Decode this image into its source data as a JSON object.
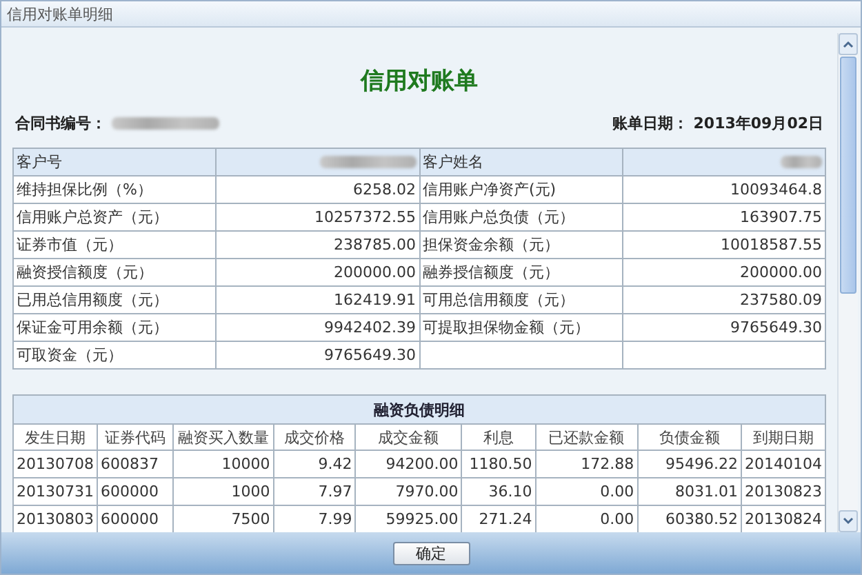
{
  "window": {
    "title": "信用对账单明细"
  },
  "statement": {
    "title": "信用对账单",
    "contract_label": "合同书编号：",
    "date_label": "账单日期：",
    "date": "2013年09月02日"
  },
  "summary": {
    "rows": [
      {
        "highlighted": true,
        "cells": [
          {
            "kind": "label",
            "text": "客户号"
          },
          {
            "kind": "redacted"
          },
          {
            "kind": "label",
            "text": "客户姓名"
          },
          {
            "kind": "redacted"
          }
        ]
      },
      {
        "highlighted": false,
        "cells": [
          {
            "kind": "label",
            "text": "维持担保比例（%）"
          },
          {
            "kind": "value",
            "text": "6258.02"
          },
          {
            "kind": "label",
            "text": "信用账户净资产(元)"
          },
          {
            "kind": "value",
            "text": "10093464.8"
          }
        ]
      },
      {
        "highlighted": false,
        "cells": [
          {
            "kind": "label",
            "text": "信用账户总资产（元）"
          },
          {
            "kind": "value",
            "text": "10257372.55"
          },
          {
            "kind": "label",
            "text": "信用账户总负债（元）"
          },
          {
            "kind": "value",
            "text": "163907.75"
          }
        ]
      },
      {
        "highlighted": false,
        "cells": [
          {
            "kind": "label",
            "text": "证券市值（元）"
          },
          {
            "kind": "value",
            "text": "238785.00"
          },
          {
            "kind": "label",
            "text": "担保资金余额（元）"
          },
          {
            "kind": "value",
            "text": "10018587.55"
          }
        ]
      },
      {
        "highlighted": false,
        "cells": [
          {
            "kind": "label",
            "text": "融资授信额度（元）"
          },
          {
            "kind": "value",
            "text": "200000.00"
          },
          {
            "kind": "label",
            "text": "融券授信额度（元）"
          },
          {
            "kind": "value",
            "text": "200000.00"
          }
        ]
      },
      {
        "highlighted": false,
        "cells": [
          {
            "kind": "label",
            "text": "已用总信用额度（元）"
          },
          {
            "kind": "value",
            "text": "162419.91"
          },
          {
            "kind": "label",
            "text": "可用总信用额度（元）"
          },
          {
            "kind": "value",
            "text": "237580.09"
          }
        ]
      },
      {
        "highlighted": false,
        "cells": [
          {
            "kind": "label",
            "text": "保证金可用余额（元）"
          },
          {
            "kind": "value",
            "text": "9942402.39"
          },
          {
            "kind": "label",
            "text": "可提取担保物金额（元）"
          },
          {
            "kind": "value",
            "text": "9765649.30"
          }
        ]
      },
      {
        "highlighted": false,
        "cells": [
          {
            "kind": "label",
            "text": "可取资金（元）"
          },
          {
            "kind": "value",
            "text": "9765649.30"
          },
          {
            "kind": "empty"
          },
          {
            "kind": "empty"
          }
        ]
      }
    ]
  },
  "detail": {
    "title": "融资负债明细",
    "columns": [
      "发生日期",
      "证券代码",
      "融资买入数量",
      "成交价格",
      "成交金额",
      "利息",
      "已还款金额",
      "负债金额",
      "到期日期"
    ],
    "rows": [
      [
        "20130708",
        "600837",
        "10000",
        "9.42",
        "94200.00",
        "1180.50",
        "172.88",
        "95496.22",
        "20140104"
      ],
      [
        "20130731",
        "600000",
        "1000",
        "7.97",
        "7970.00",
        "36.10",
        "0.00",
        "8031.01",
        "20130823"
      ],
      [
        "20130803",
        "600000",
        "7500",
        "7.99",
        "59925.00",
        "271.24",
        "0.00",
        "60380.52",
        "20130824"
      ]
    ]
  },
  "buttons": [
    "确定"
  ]
}
